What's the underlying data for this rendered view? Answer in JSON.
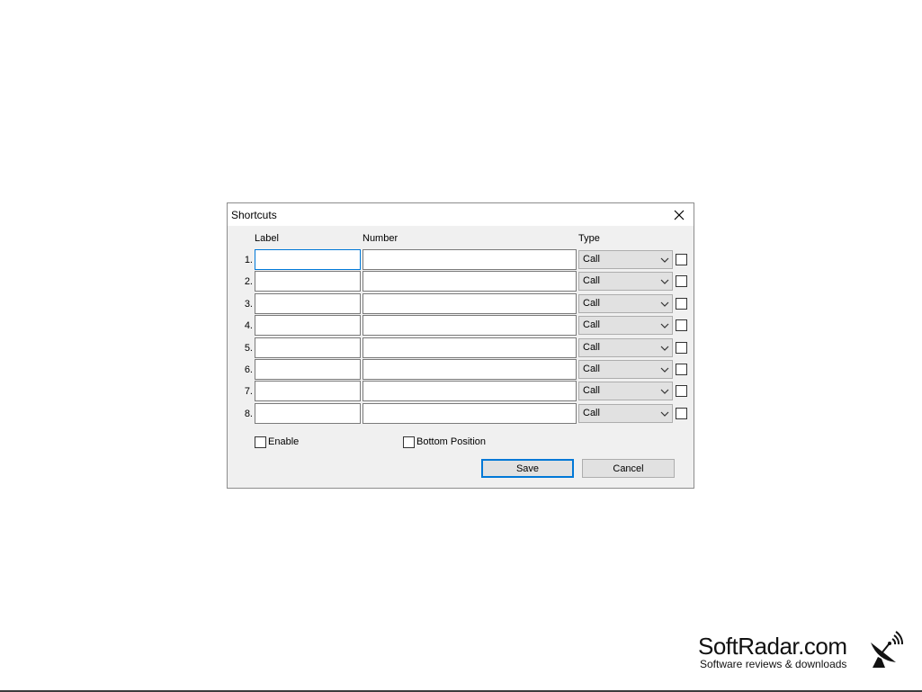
{
  "dialog": {
    "title": "Shortcuts",
    "headers": {
      "label": "Label",
      "number": "Number",
      "type": "Type"
    },
    "rows": [
      {
        "num": "1.",
        "label": "",
        "number": "",
        "type": "Call",
        "checked": false,
        "focused": true
      },
      {
        "num": "2.",
        "label": "",
        "number": "",
        "type": "Call",
        "checked": false
      },
      {
        "num": "3.",
        "label": "",
        "number": "",
        "type": "Call",
        "checked": false
      },
      {
        "num": "4.",
        "label": "",
        "number": "",
        "type": "Call",
        "checked": false
      },
      {
        "num": "5.",
        "label": "",
        "number": "",
        "type": "Call",
        "checked": false
      },
      {
        "num": "6.",
        "label": "",
        "number": "",
        "type": "Call",
        "checked": false
      },
      {
        "num": "7.",
        "label": "",
        "number": "",
        "type": "Call",
        "checked": false
      },
      {
        "num": "8.",
        "label": "",
        "number": "",
        "type": "Call",
        "checked": false
      }
    ],
    "enable_label": "Enable",
    "enable_checked": false,
    "bottom_position_label": "Bottom Position",
    "bottom_position_checked": false,
    "save_label": "Save",
    "cancel_label": "Cancel"
  },
  "watermark": {
    "name": "SoftRadar.com",
    "tagline": "Software reviews & downloads"
  },
  "colors": {
    "dialog_bg": "#f0f0f0",
    "focus_accent": "#0078d7",
    "button_bg": "#e1e1e1"
  },
  "icons": {
    "close": "close-icon",
    "dropdown": "chevron-down-icon",
    "logo": "satellite-dish-icon"
  }
}
